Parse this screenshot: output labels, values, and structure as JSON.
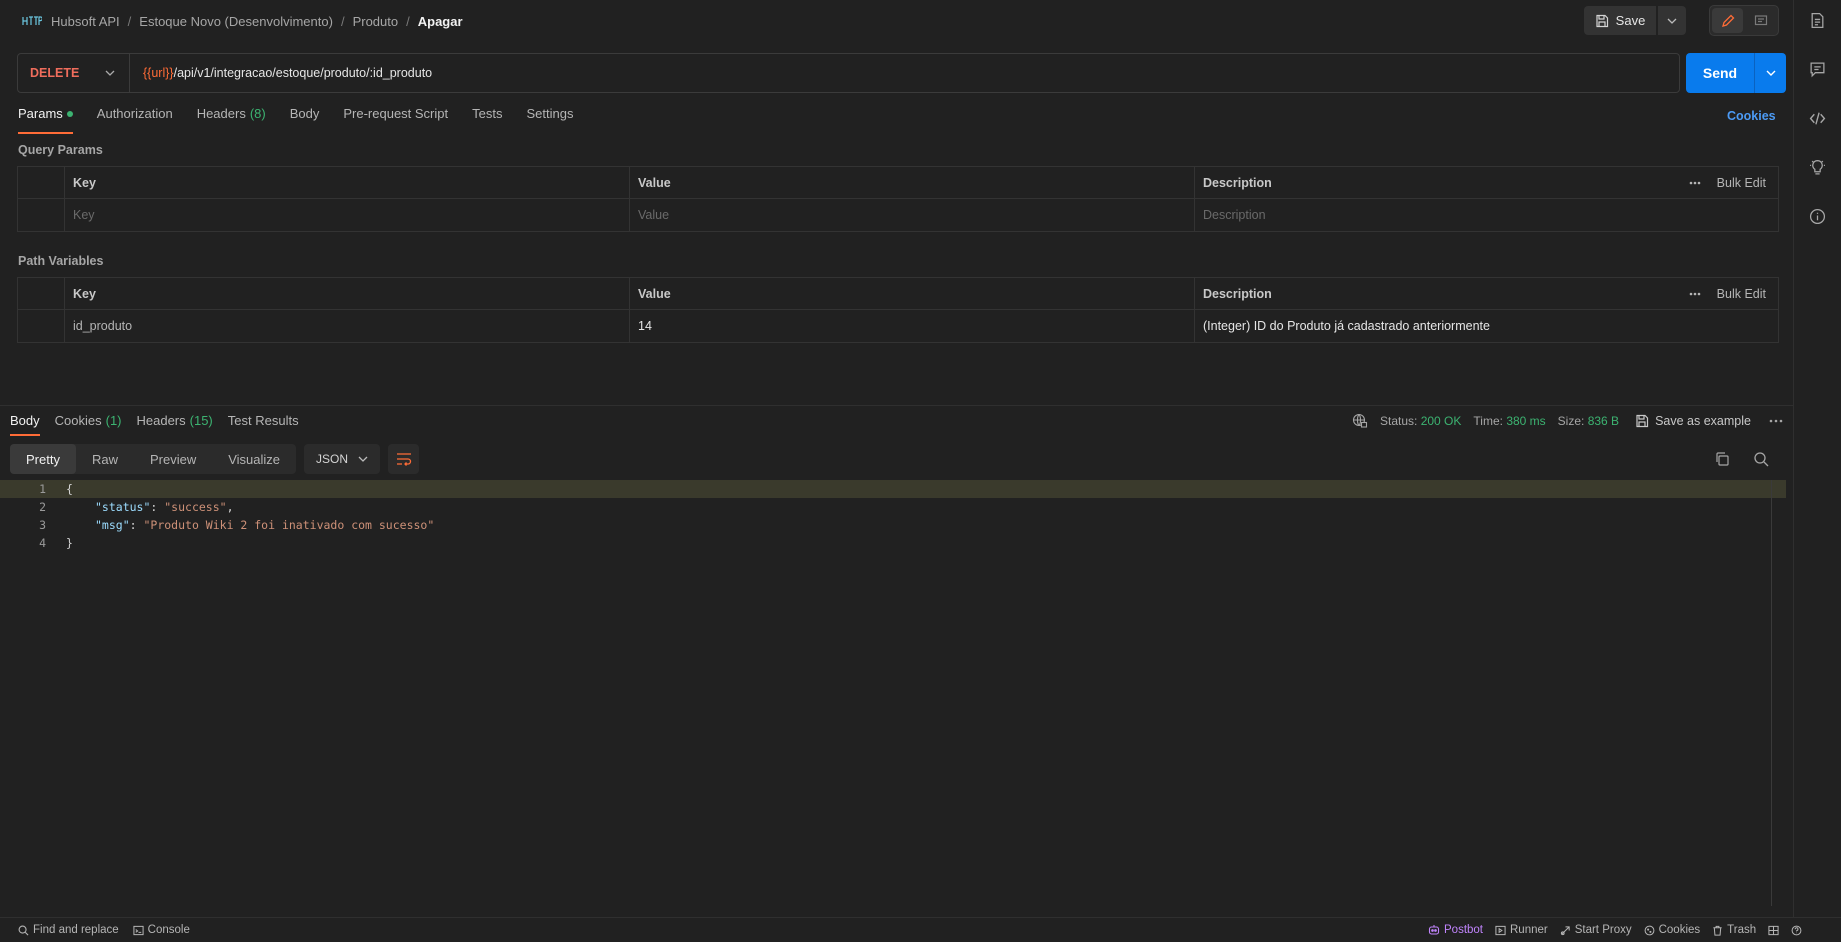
{
  "breadcrumb": {
    "items": [
      "Hubsoft API",
      "Estoque Novo (Desenvolvimento)",
      "Produto"
    ],
    "current": "Apagar",
    "separator": "/"
  },
  "header": {
    "save_label": "Save"
  },
  "request": {
    "method": "DELETE",
    "url_variable": "{{url}}",
    "url_path": "/api/v1/integracao/estoque/produto/:id_produto",
    "send_label": "Send"
  },
  "request_tabs": {
    "params": "Params",
    "authorization": "Authorization",
    "headers": "Headers",
    "headers_count": "(8)",
    "body": "Body",
    "pre_request": "Pre-request Script",
    "tests": "Tests",
    "settings": "Settings",
    "cookies": "Cookies"
  },
  "query_params": {
    "title": "Query Params",
    "columns": {
      "key": "Key",
      "value": "Value",
      "description": "Description",
      "bulk_edit": "Bulk Edit"
    },
    "placeholder": {
      "key": "Key",
      "value": "Value",
      "description": "Description"
    }
  },
  "path_variables": {
    "title": "Path Variables",
    "columns": {
      "key": "Key",
      "value": "Value",
      "description": "Description",
      "bulk_edit": "Bulk Edit"
    },
    "rows": [
      {
        "key": "id_produto",
        "value": "14",
        "description": "(Integer) ID do Produto já cadastrado anteriormente"
      }
    ]
  },
  "response_tabs": {
    "body": "Body",
    "cookies": "Cookies",
    "cookies_count": "(1)",
    "headers": "Headers",
    "headers_count": "(15)",
    "test_results": "Test Results"
  },
  "response_meta": {
    "status_label": "Status:",
    "status_value": "200 OK",
    "time_label": "Time:",
    "time_value": "380 ms",
    "size_label": "Size:",
    "size_value": "836 B",
    "save_example": "Save as example"
  },
  "view_modes": [
    "Pretty",
    "Raw",
    "Preview",
    "Visualize"
  ],
  "format": "JSON",
  "response_body": {
    "line_numbers": [
      "1",
      "2",
      "3",
      "4"
    ],
    "open_brace": "{",
    "close_brace": "}",
    "status_key": "\"status\"",
    "status_value": "\"success\"",
    "msg_key": "\"msg\"",
    "msg_value": "\"Produto Wiki 2 foi inativado com sucesso\""
  },
  "status_bar": {
    "find_replace": "Find and replace",
    "console": "Console",
    "postbot": "Postbot",
    "runner": "Runner",
    "start_proxy": "Start Proxy",
    "cookies": "Cookies",
    "trash": "Trash"
  },
  "colors": {
    "accent": "#ff6c37",
    "send": "#097bed",
    "success": "#3cb371",
    "method_delete": "#f06d5c",
    "link": "#4c9bf5"
  }
}
